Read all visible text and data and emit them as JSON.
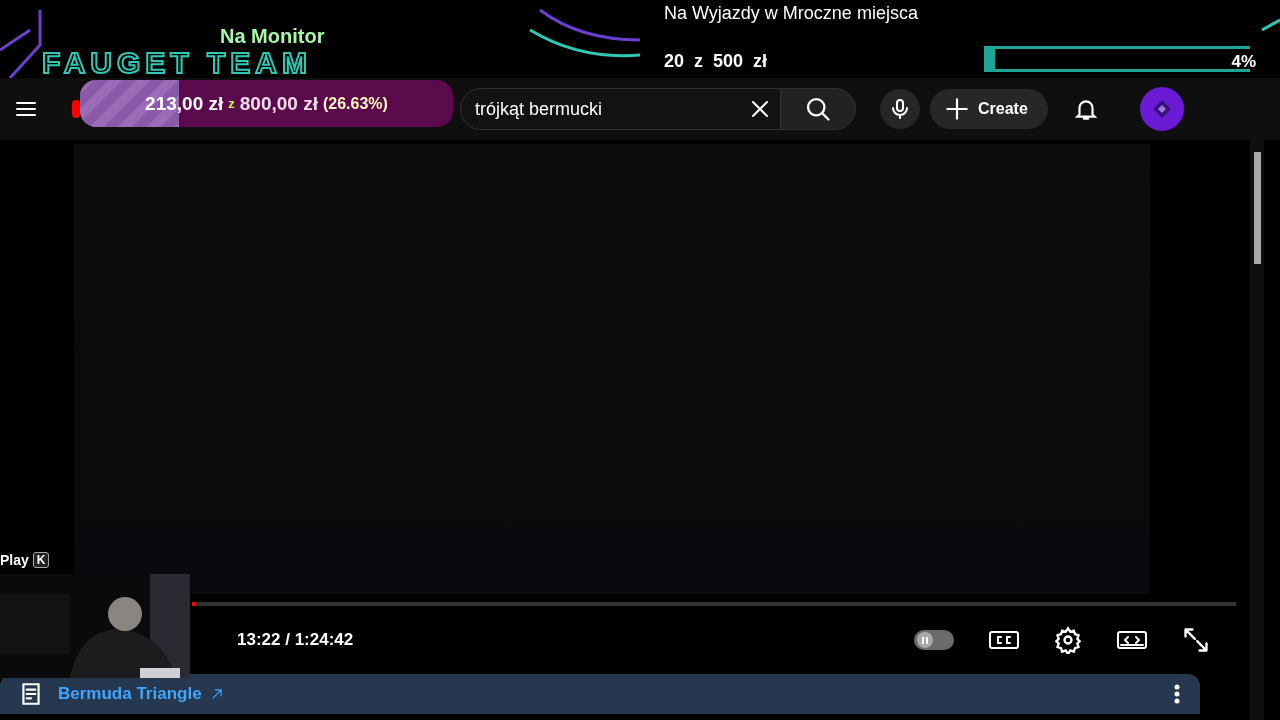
{
  "overlay": {
    "subtitle": "Na Monitor",
    "team_name": "FAUGET TEAM",
    "goal": {
      "title": "Na Wyjazdy w Mroczne miejsca",
      "amount": "20  z  500  zł",
      "percent": "4%",
      "level": 0.04
    },
    "donation": {
      "raised": "213,00 zł",
      "separator": "z",
      "target": "800,00 zł",
      "percent": "(26.63%)",
      "level": 0.2663
    }
  },
  "header": {
    "search": {
      "value": "trójkąt bermucki"
    },
    "create_label": "Create"
  },
  "player": {
    "tooltip": {
      "label": "Play",
      "key": "K"
    },
    "progress": {
      "level": 0.004
    },
    "time": "13:22 / 1:24:42",
    "autoplay": {
      "on": false
    }
  },
  "info_bar": {
    "link": "Bermuda Triangle"
  }
}
